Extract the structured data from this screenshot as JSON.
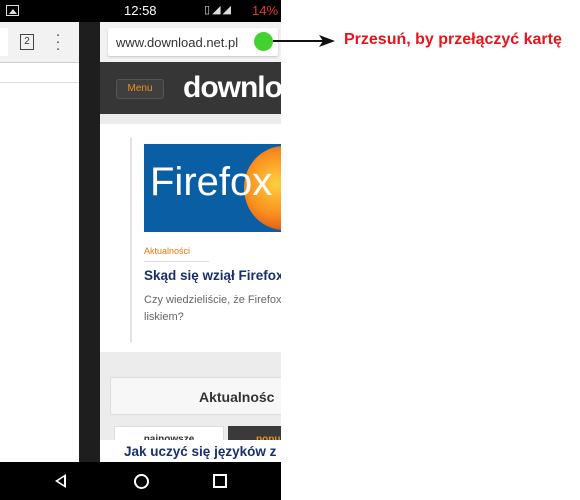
{
  "status_bar": {
    "time": "12:58",
    "battery": "14%",
    "icons": [
      "image-icon",
      "vibrate-icon",
      "wifi-icon",
      "signal-icon",
      "battery-icon"
    ]
  },
  "left_tab": {
    "tab_count": "2",
    "menu_icon": "more-vert-icon"
  },
  "browser": {
    "url": "www.download.net.pl",
    "status_dot_color": "#43d12f"
  },
  "site": {
    "menu_label": "Menu",
    "logo_text": "downlo",
    "accent": "#f28e1d",
    "hero_text": "Firefox",
    "category": "Aktualności",
    "headline": "Skąd się wziął Firefox",
    "excerpt": "Czy wiedzieliście, że Firefox liskiem?",
    "section_title": "Aktualnośc",
    "tabs": [
      "najnowsze",
      "popu"
    ],
    "bottom_headline": "Jak uczyć się języków z"
  },
  "nav_bar": {
    "buttons": [
      "back-icon",
      "home-icon",
      "recents-icon"
    ]
  },
  "annotation": {
    "text": "Przesuń, by przełączyć kartę",
    "color": "#e8141c"
  }
}
